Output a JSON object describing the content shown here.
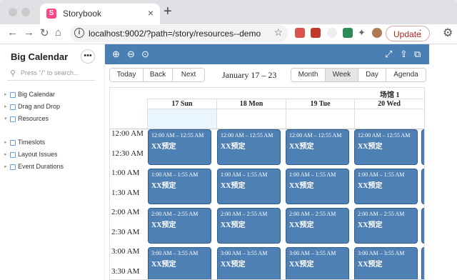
{
  "browser": {
    "tab_title": "Storybook",
    "new_tab": "+",
    "url": "localhost:9002/?path=/story/resources--demo",
    "update_label": "Update"
  },
  "sidebar": {
    "title": "Big Calendar",
    "search_placeholder": "Press \"/\" to search...",
    "items": [
      {
        "label": "Big Calendar",
        "expanded": false
      },
      {
        "label": "Drag and Drop",
        "expanded": false
      },
      {
        "label": "Resources",
        "expanded": true
      },
      {
        "label": "Timeslots",
        "expanded": false
      },
      {
        "label": "Layout Issues",
        "expanded": false
      },
      {
        "label": "Event Durations",
        "expanded": false
      }
    ]
  },
  "calendar": {
    "nav": {
      "today": "Today",
      "back": "Back",
      "next": "Next"
    },
    "range_label": "January 17 – 23",
    "views": [
      {
        "label": "Month",
        "active": false
      },
      {
        "label": "Week",
        "active": true
      },
      {
        "label": "Day",
        "active": false
      },
      {
        "label": "Agenda",
        "active": false
      }
    ],
    "resource": "场馆 1",
    "days": [
      "17 Sun",
      "18 Mon",
      "19 Tue",
      "20 Wed"
    ],
    "time_slots": [
      "12:00 AM",
      "12:30 AM",
      "1:00 AM",
      "1:30 AM",
      "2:00 AM",
      "2:30 AM",
      "3:00 AM",
      "3:30 AM"
    ],
    "event_rows": [
      {
        "time": "12:00 AM – 12:55 AM",
        "title": "XX预定"
      },
      {
        "time": "1:00 AM – 1:55 AM",
        "title": "XX预定"
      },
      {
        "time": "2:00 AM – 2:55 AM",
        "title": "XX预定"
      },
      {
        "time": "3:00 AM – 3:55 AM",
        "title": "XX预定"
      }
    ],
    "event_color": "#4e80b4"
  }
}
